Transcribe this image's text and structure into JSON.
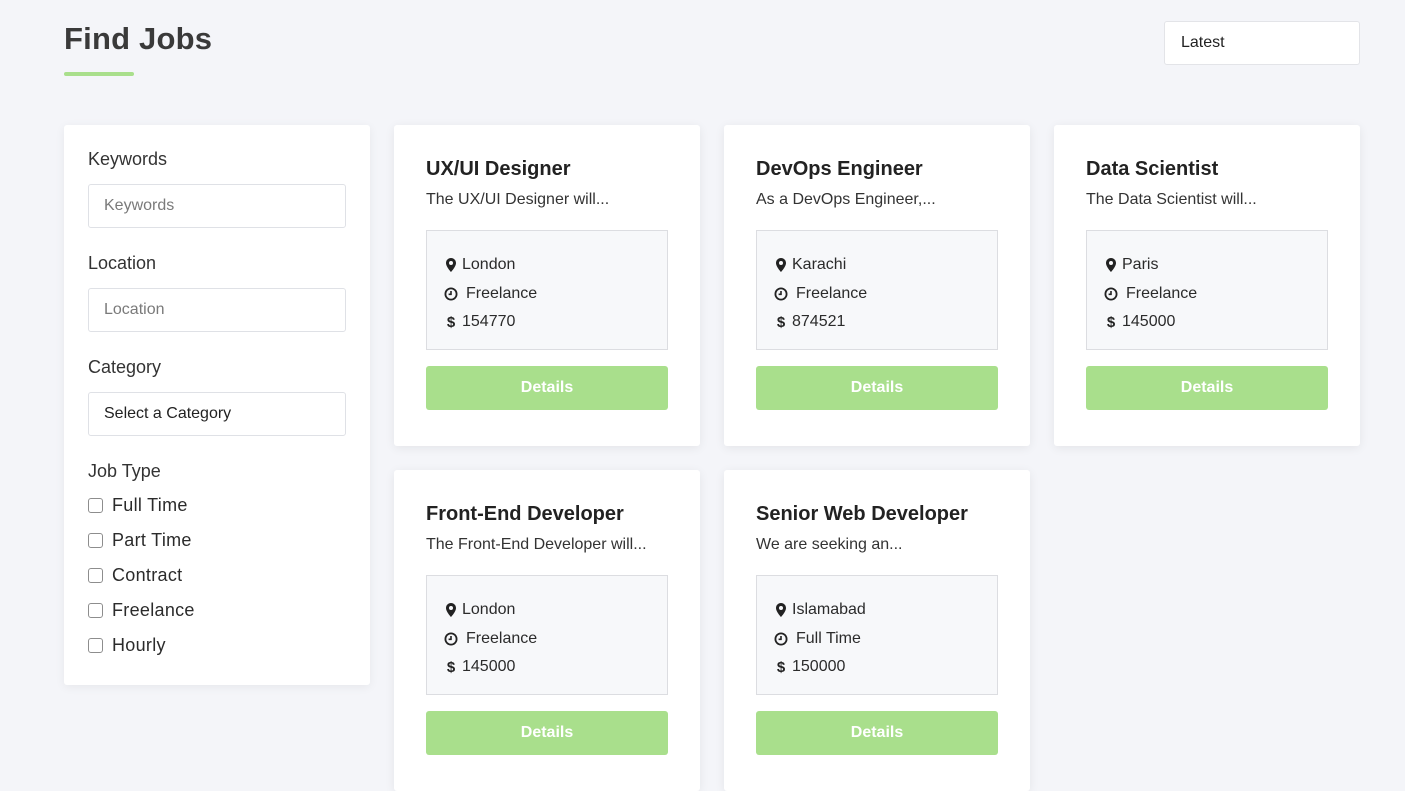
{
  "colors": {
    "accent": "#a9df8c",
    "background": "#f4f5f9"
  },
  "header": {
    "title": "Find Jobs",
    "sort_value": "Latest"
  },
  "filters": {
    "keywords_label": "Keywords",
    "keywords_placeholder": "Keywords",
    "location_label": "Location",
    "location_placeholder": "Location",
    "category_label": "Category",
    "category_value": "Select a Category",
    "job_type_label": "Job Type",
    "job_types": [
      "Full Time",
      "Part Time",
      "Contract",
      "Freelance",
      "Hourly"
    ]
  },
  "icons": {
    "location": "map-pin-icon",
    "type": "clock-icon",
    "salary": "dollar-icon"
  },
  "jobs": [
    {
      "title": "UX/UI Designer",
      "description": "The UX/UI Designer will...",
      "location": "London",
      "type": "Freelance",
      "salary": "154770",
      "button": "Details"
    },
    {
      "title": "DevOps Engineer",
      "description": "As a DevOps Engineer,...",
      "location": "Karachi",
      "type": "Freelance",
      "salary": "874521",
      "button": "Details"
    },
    {
      "title": "Data Scientist",
      "description": "The Data Scientist will...",
      "location": "Paris",
      "type": "Freelance",
      "salary": "145000",
      "button": "Details"
    },
    {
      "title": "Front-End Developer",
      "description": "The Front-End Developer will...",
      "location": "London",
      "type": "Freelance",
      "salary": "145000",
      "button": "Details"
    },
    {
      "title": "Senior Web Developer",
      "description": "We are seeking an...",
      "location": "Islamabad",
      "type": "Full Time",
      "salary": "150000",
      "button": "Details"
    }
  ]
}
